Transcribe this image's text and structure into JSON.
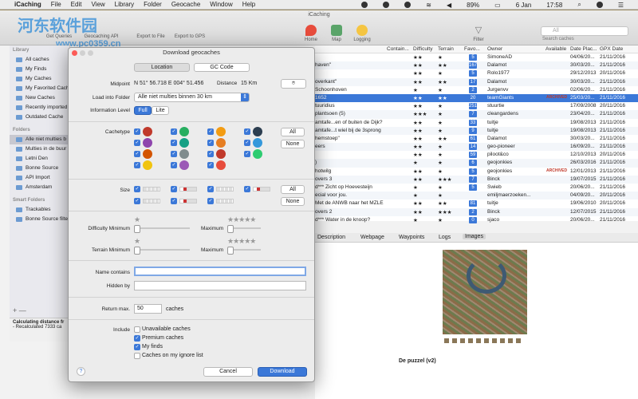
{
  "menubar": {
    "items": [
      "iCaching",
      "File",
      "Edit",
      "View",
      "Library",
      "Folder",
      "Geocache",
      "Window",
      "Help"
    ],
    "battery": "89%",
    "date": "6 Jan",
    "time": "17:58"
  },
  "window": {
    "title": "iCaching",
    "toolbar_left": [
      "Get Queries",
      "Geocaching API",
      "Export to File",
      "Export to GPS"
    ],
    "toolbar_center": [
      "Home",
      "Map",
      "Logging"
    ],
    "filter_label": "Filter",
    "search_label": "Search caches",
    "search_placeholder": "All"
  },
  "watermark": {
    "line1": "河东软件园",
    "line2": "www.pc0359.cn"
  },
  "sidebar": {
    "library_header": "Library",
    "library_items": [
      "All caches",
      "My Finds",
      "My Caches",
      "My Favorited Caches",
      "New Caches",
      "Recently imported",
      "Outdated Cache"
    ],
    "folders_header": "Folders",
    "folder_items": [
      "Alle niet multies b",
      "Multies in de buur",
      "Letni Den",
      "Bonne Source",
      "API Import",
      "Amsterdam"
    ],
    "smart_header": "Smart Folders",
    "smart_items": [
      "Trackables",
      "Bonne Source filte"
    ],
    "status_title": "Calculating distance fr",
    "status_text": "- Recalculated 7333 ca"
  },
  "table": {
    "headers": [
      "Contain...",
      "Difficulty",
      "Terrain",
      "Favo...",
      "Owner",
      "Available",
      "Date Plac...",
      "GPX Date"
    ],
    "rows": [
      {
        "name": "",
        "fav": "5",
        "owner": "SimoneAD",
        "placed": "04/06/20...",
        "gpx": "21/11/2016",
        "dif": "★★",
        "ter": "★",
        "sel": false
      },
      {
        "name": "haven\"",
        "fav": "167",
        "owner": "Dalamot",
        "placed": "30/03/20...",
        "gpx": "21/11/2016",
        "dif": "★★",
        "ter": "★★",
        "sel": false
      },
      {
        "name": "",
        "fav": "5",
        "owner": "Rolo1977",
        "placed": "29/12/2013",
        "gpx": "20/11/2016",
        "dif": "★★",
        "ter": "★",
        "sel": false
      },
      {
        "name": "overkant\"",
        "fav": "17",
        "owner": "Dalamot",
        "placed": "30/03/20...",
        "gpx": "21/11/2016",
        "dif": "★★",
        "ter": "★★",
        "sel": false
      },
      {
        "name": "Schoonhoven",
        "fav": "2",
        "owner": "Jurgenvv",
        "placed": "02/06/20...",
        "gpx": "21/11/2016",
        "dif": "★",
        "ter": "★",
        "sel": false
      },
      {
        "name": "1652",
        "fav": "20",
        "owner": "teamGiants",
        "placed": "25/03/20...",
        "gpx": "21/11/2016",
        "dif": "★★",
        "ter": "★★",
        "sel": true
      },
      {
        "name": "tuuridius",
        "fav": "251",
        "owner": "stuurtie",
        "placed": "17/09/2008",
        "gpx": "20/11/2016",
        "dif": "★★",
        "ter": "★",
        "sel": false
      },
      {
        "name": "plantsoen (5)",
        "fav": "7",
        "owner": "cleangardens",
        "placed": "23/04/20...",
        "gpx": "21/11/2016",
        "dif": "★★★",
        "ter": "★",
        "sel": false
      },
      {
        "name": "amtafe...en of buiten de Dijk?",
        "fav": "33",
        "owner": "tuitje",
        "placed": "19/08/2013",
        "gpx": "21/11/2016",
        "dif": "★★",
        "ter": "★",
        "sel": false
      },
      {
        "name": "amtafe...t wiel bij de 3sprong",
        "fav": "9",
        "owner": "tuitje",
        "placed": "19/08/2013",
        "gpx": "21/11/2016",
        "dif": "★★",
        "ter": "★",
        "sel": false
      },
      {
        "name": "hemstoep\"",
        "fav": "61",
        "owner": "Dalamot",
        "placed": "30/03/20...",
        "gpx": "21/11/2016",
        "dif": "★★",
        "ter": "★★",
        "sel": false
      },
      {
        "name": "eers",
        "fav": "14",
        "owner": "geo-pioneer",
        "placed": "16/09/20...",
        "gpx": "21/11/2016",
        "dif": "★★",
        "ter": "★",
        "sel": false
      },
      {
        "name": "",
        "fav": "59",
        "owner": "piloot&co",
        "placed": "12/10/2013",
        "gpx": "20/11/2016",
        "dif": "★★",
        "ter": "★",
        "sel": false
      },
      {
        "name": ")",
        "fav": "6",
        "owner": "geojonkies",
        "placed": "26/03/2016",
        "gpx": "21/11/2016",
        "dif": "★",
        "ter": "★",
        "sel": false
      },
      {
        "name": "hotwilg",
        "fav": "5",
        "owner": "geojonkies",
        "placed": "12/01/2013",
        "gpx": "21/11/2016",
        "dif": "★★",
        "ter": "★",
        "sel": false
      },
      {
        "name": "overs 3",
        "fav": "7",
        "owner": "Binck",
        "placed": "19/07/2015",
        "gpx": "21/11/2016",
        "dif": "★★",
        "ter": "★★★",
        "sel": false
      },
      {
        "name": "d*** Zicht op Hoevesteijn",
        "fav": "5",
        "owner": "Swieb",
        "placed": "20/06/20...",
        "gpx": "21/11/2016",
        "dif": "★",
        "ter": "★",
        "sel": false
      },
      {
        "name": "ecial voor jou.",
        "fav": "",
        "owner": "emiljmaerzoeken...",
        "placed": "04/09/20...",
        "gpx": "20/11/2016",
        "dif": "★",
        "ter": "★",
        "sel": false
      },
      {
        "name": "Met de ANWB naar het MZLE",
        "fav": "81",
        "owner": "tuitje",
        "placed": "19/06/2010",
        "gpx": "20/11/2016",
        "dif": "★★",
        "ter": "★★",
        "sel": false
      },
      {
        "name": "overs 2",
        "fav": "2",
        "owner": "Binck",
        "placed": "12/07/2015",
        "gpx": "21/11/2016",
        "dif": "★★",
        "ter": "★★★",
        "sel": false
      },
      {
        "name": "d*** Water in de knoop?",
        "fav": "0",
        "owner": "sjaco",
        "placed": "20/06/20...",
        "gpx": "21/11/2016",
        "dif": "★",
        "ter": "★",
        "sel": false
      }
    ],
    "archived_label": "ARCHIVED"
  },
  "detail": {
    "tabs": [
      "Description",
      "Webpage",
      "Waypoints",
      "Logs",
      "Images"
    ],
    "selected_tab": "Images",
    "photo_caption": "De puzzel (v2)"
  },
  "dialog": {
    "title": "Download geocaches",
    "segment_location": "Location",
    "segment_gc": "GC Code",
    "midpoint_label": "Midpoint",
    "midpoint_value": "N 51° 56.718 E 004° 51.456",
    "distance_label": "Distance",
    "distance_value": "15 Km",
    "folder_label": "Load into Folder",
    "folder_value": "Alle niet multies binnen 30 km",
    "info_label": "Information Level",
    "info_full": "Full",
    "info_lite": "Lite",
    "cachetype_label": "Cachetype",
    "all_label": "All",
    "none_label": "None",
    "size_label": "Size",
    "diff_min_label": "Difficulty Minimum",
    "terr_min_label": "Terrain Minimum",
    "maximum_label": "Maximum",
    "name_contains_label": "Name contains",
    "hidden_by_label": "Hidden by",
    "return_max_label": "Return max.",
    "return_max_value": "50",
    "caches_label": "caches",
    "include_label": "Include",
    "include_options": [
      {
        "label": "Unavailable caches",
        "checked": false
      },
      {
        "label": "Premium caches",
        "checked": true
      },
      {
        "label": "My finds",
        "checked": true
      },
      {
        "label": "Caches on my ignore list",
        "checked": false
      }
    ],
    "help_label": "?",
    "cancel_label": "Cancel",
    "download_label": "Download"
  },
  "colors": {
    "accent": "#3b78d8",
    "selection": "#3b78d8",
    "archived": "#c0392b"
  }
}
